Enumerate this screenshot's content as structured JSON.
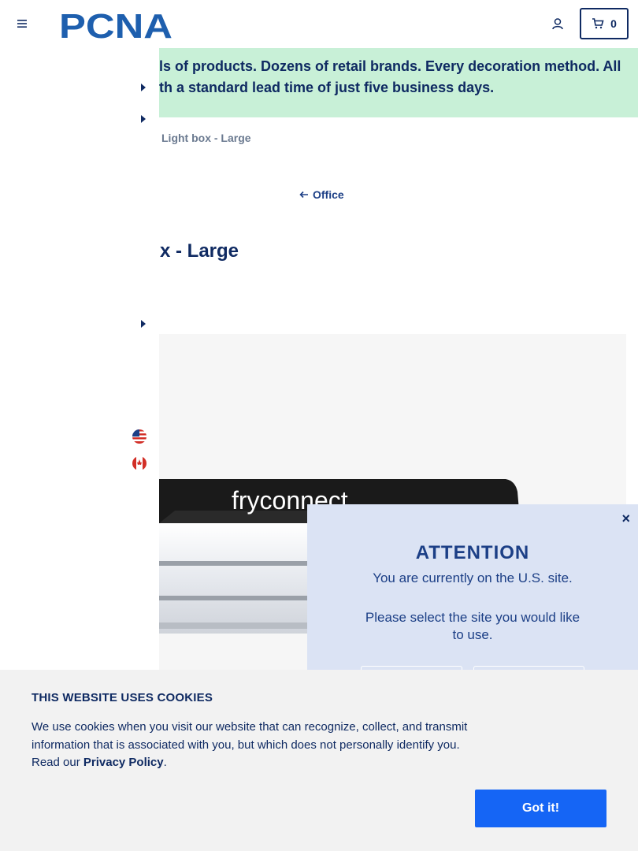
{
  "header": {
    "logo_text": "PCNA",
    "cart_count": "0"
  },
  "promo": {
    "line1": "ls of products. Dozens of retail brands. Every decoration method. All",
    "line2": "th a standard lead time of just five business days."
  },
  "breadcrumb": "Light box - Large",
  "back_link": "Office",
  "product_title": "x - Large",
  "product_image": {
    "brand_text": "fryconnect"
  },
  "attention": {
    "close": "×",
    "heading": "ATTENTION",
    "message1": "You are currently on the U.S. site.",
    "message2": "Please select the site you would like to use."
  },
  "cookie": {
    "heading": "THIS WEBSITE USES COOKIES",
    "text_before": "We use cookies when you visit our website that can recognize, collect, and transmit information that is associated with you, but which does not personally identify you. Read our ",
    "link": "Privacy Policy",
    "text_after": ".",
    "button": "Got it!"
  },
  "colors": {
    "navy": "#0f2a62",
    "promo_bg": "#c8f0d7",
    "modal_bg": "#dbe3f4",
    "button_blue": "#1565f5"
  }
}
